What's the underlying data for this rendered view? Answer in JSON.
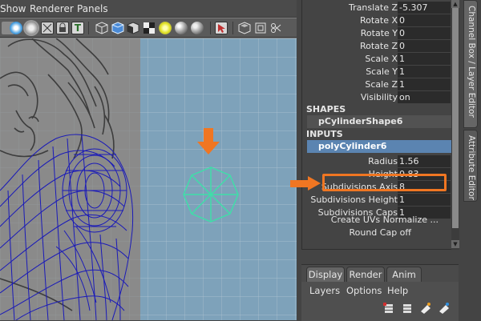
{
  "viewport": {
    "menus": [
      {
        "label": "Show"
      },
      {
        "label": "Renderer"
      },
      {
        "label": "Panels"
      }
    ],
    "toolbar_icons": [
      "camera-icon",
      "smooth-shade-icon",
      "wireframe-icon",
      "xray-icon",
      "lock-icon",
      "texture-icon",
      "isolate-cube-icon",
      "bounding-box-icon",
      "checker-icon",
      "light-icon",
      "shadow-sphere-icon",
      "ambient-sphere-icon",
      "select-cursor-icon",
      "grid-toggle-icon",
      "film-gate-icon",
      "resolution-gate-icon"
    ],
    "colors": {
      "wireframe": "#1a1ab8",
      "selected_object": "#3de0a8",
      "annotation": "#f07622",
      "grid_bg": "#7ea2ba",
      "sketch_bg": "#8a8a8a"
    }
  },
  "channel_box": {
    "transform_channels": [
      {
        "label": "Translate Z",
        "value": "-5.307"
      },
      {
        "label": "Rotate X",
        "value": "0"
      },
      {
        "label": "Rotate Y",
        "value": "0"
      },
      {
        "label": "Rotate Z",
        "value": "0"
      },
      {
        "label": "Scale X",
        "value": "1"
      },
      {
        "label": "Scale Y",
        "value": "1"
      },
      {
        "label": "Scale Z",
        "value": "1"
      },
      {
        "label": "Visibility",
        "value": "on"
      }
    ],
    "shapes_header": "SHAPES",
    "shape_node": "pCylinderShape6",
    "inputs_header": "INPUTS",
    "input_node": "polyCylinder6",
    "input_channels": [
      {
        "label": "Radius",
        "value": "1.56"
      },
      {
        "label": "Height",
        "value": "0.83"
      },
      {
        "label": "Subdivisions Axis",
        "value": "8"
      },
      {
        "label": "Subdivisions Height",
        "value": "1"
      },
      {
        "label": "Subdivisions Caps",
        "value": "1"
      }
    ],
    "create_uvs": "Create UVs Normalize ...",
    "round_cap": "Round Cap off"
  },
  "side_tabs": {
    "channel_box_layer_editor": "Channel Box / Layer Editor",
    "attribute_editor": "Attribute Editor"
  },
  "layer_editor": {
    "tabs": [
      {
        "label": "Display",
        "active": true
      },
      {
        "label": "Render",
        "active": false
      },
      {
        "label": "Anim",
        "active": false
      }
    ],
    "menus": [
      {
        "label": "Layers"
      },
      {
        "label": "Options"
      },
      {
        "label": "Help"
      }
    ],
    "icons": [
      "new-layer-icon",
      "new-layer-selected-icon",
      "move-up-icon",
      "move-down-icon"
    ]
  }
}
